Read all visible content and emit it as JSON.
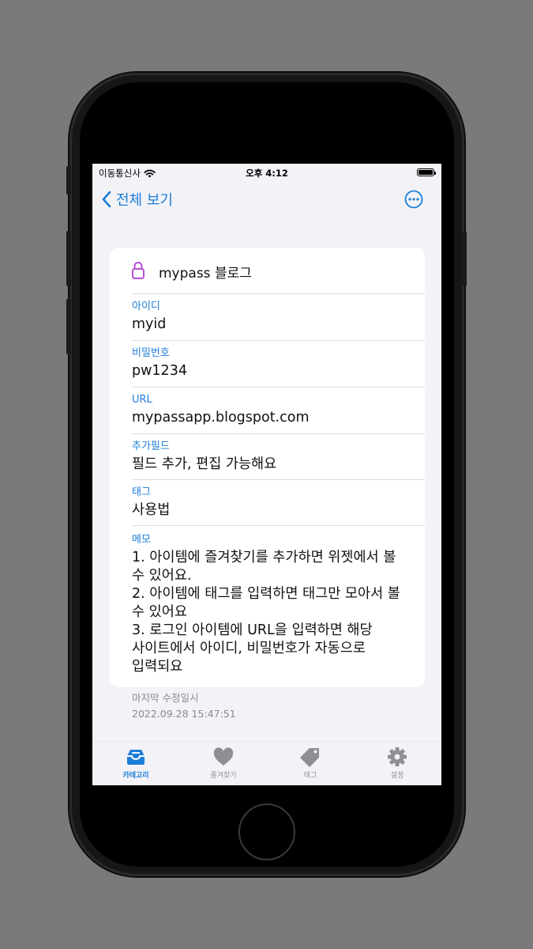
{
  "status_bar": {
    "carrier": "이동통신사",
    "time": "오후 4:12"
  },
  "nav": {
    "back_label": "전체 보기",
    "back_icon": "chevron-left-icon",
    "more_icon": "ellipsis-circle-icon"
  },
  "item": {
    "icon": "lock-icon",
    "title": "mypass 블로그",
    "fields": [
      {
        "label": "아이디",
        "value": "myid"
      },
      {
        "label": "비밀번호",
        "value": "pw1234"
      },
      {
        "label": "URL",
        "value": "mypassapp.blogspot.com"
      },
      {
        "label": "추가필드",
        "value": "필드 추가, 편집 가능해요"
      },
      {
        "label": "태그",
        "value": "사용법"
      }
    ],
    "memo": {
      "label": "메모",
      "value": "1. 아이템에 즐겨찾기를 추가하면 위젯에서 볼\n수 있어요.\n2. 아이템에 태그를 입력하면 태그만 모아서 볼\n수 있어요\n3. 로그인 아이템에 URL을 입력하면 해당\n사이트에서 아이디, 비밀번호가 자동으로\n입력되요"
    }
  },
  "meta": {
    "modified_label": "마지막 수정일시",
    "modified_value": "2022.09.28 15:47:51"
  },
  "tab_bar": {
    "tabs": [
      {
        "label": "카테고리",
        "icon": "tray-icon",
        "active": true
      },
      {
        "label": "즐겨찾기",
        "icon": "heart-icon",
        "active": false
      },
      {
        "label": "태그",
        "icon": "tag-icon",
        "active": false
      },
      {
        "label": "설정",
        "icon": "gear-icon",
        "active": false
      }
    ]
  },
  "colors": {
    "accent": "#1d7dd8",
    "lock_icon": "#b44fd6",
    "background": "#f2f2f7",
    "inactive_tab": "#8e8e93"
  }
}
